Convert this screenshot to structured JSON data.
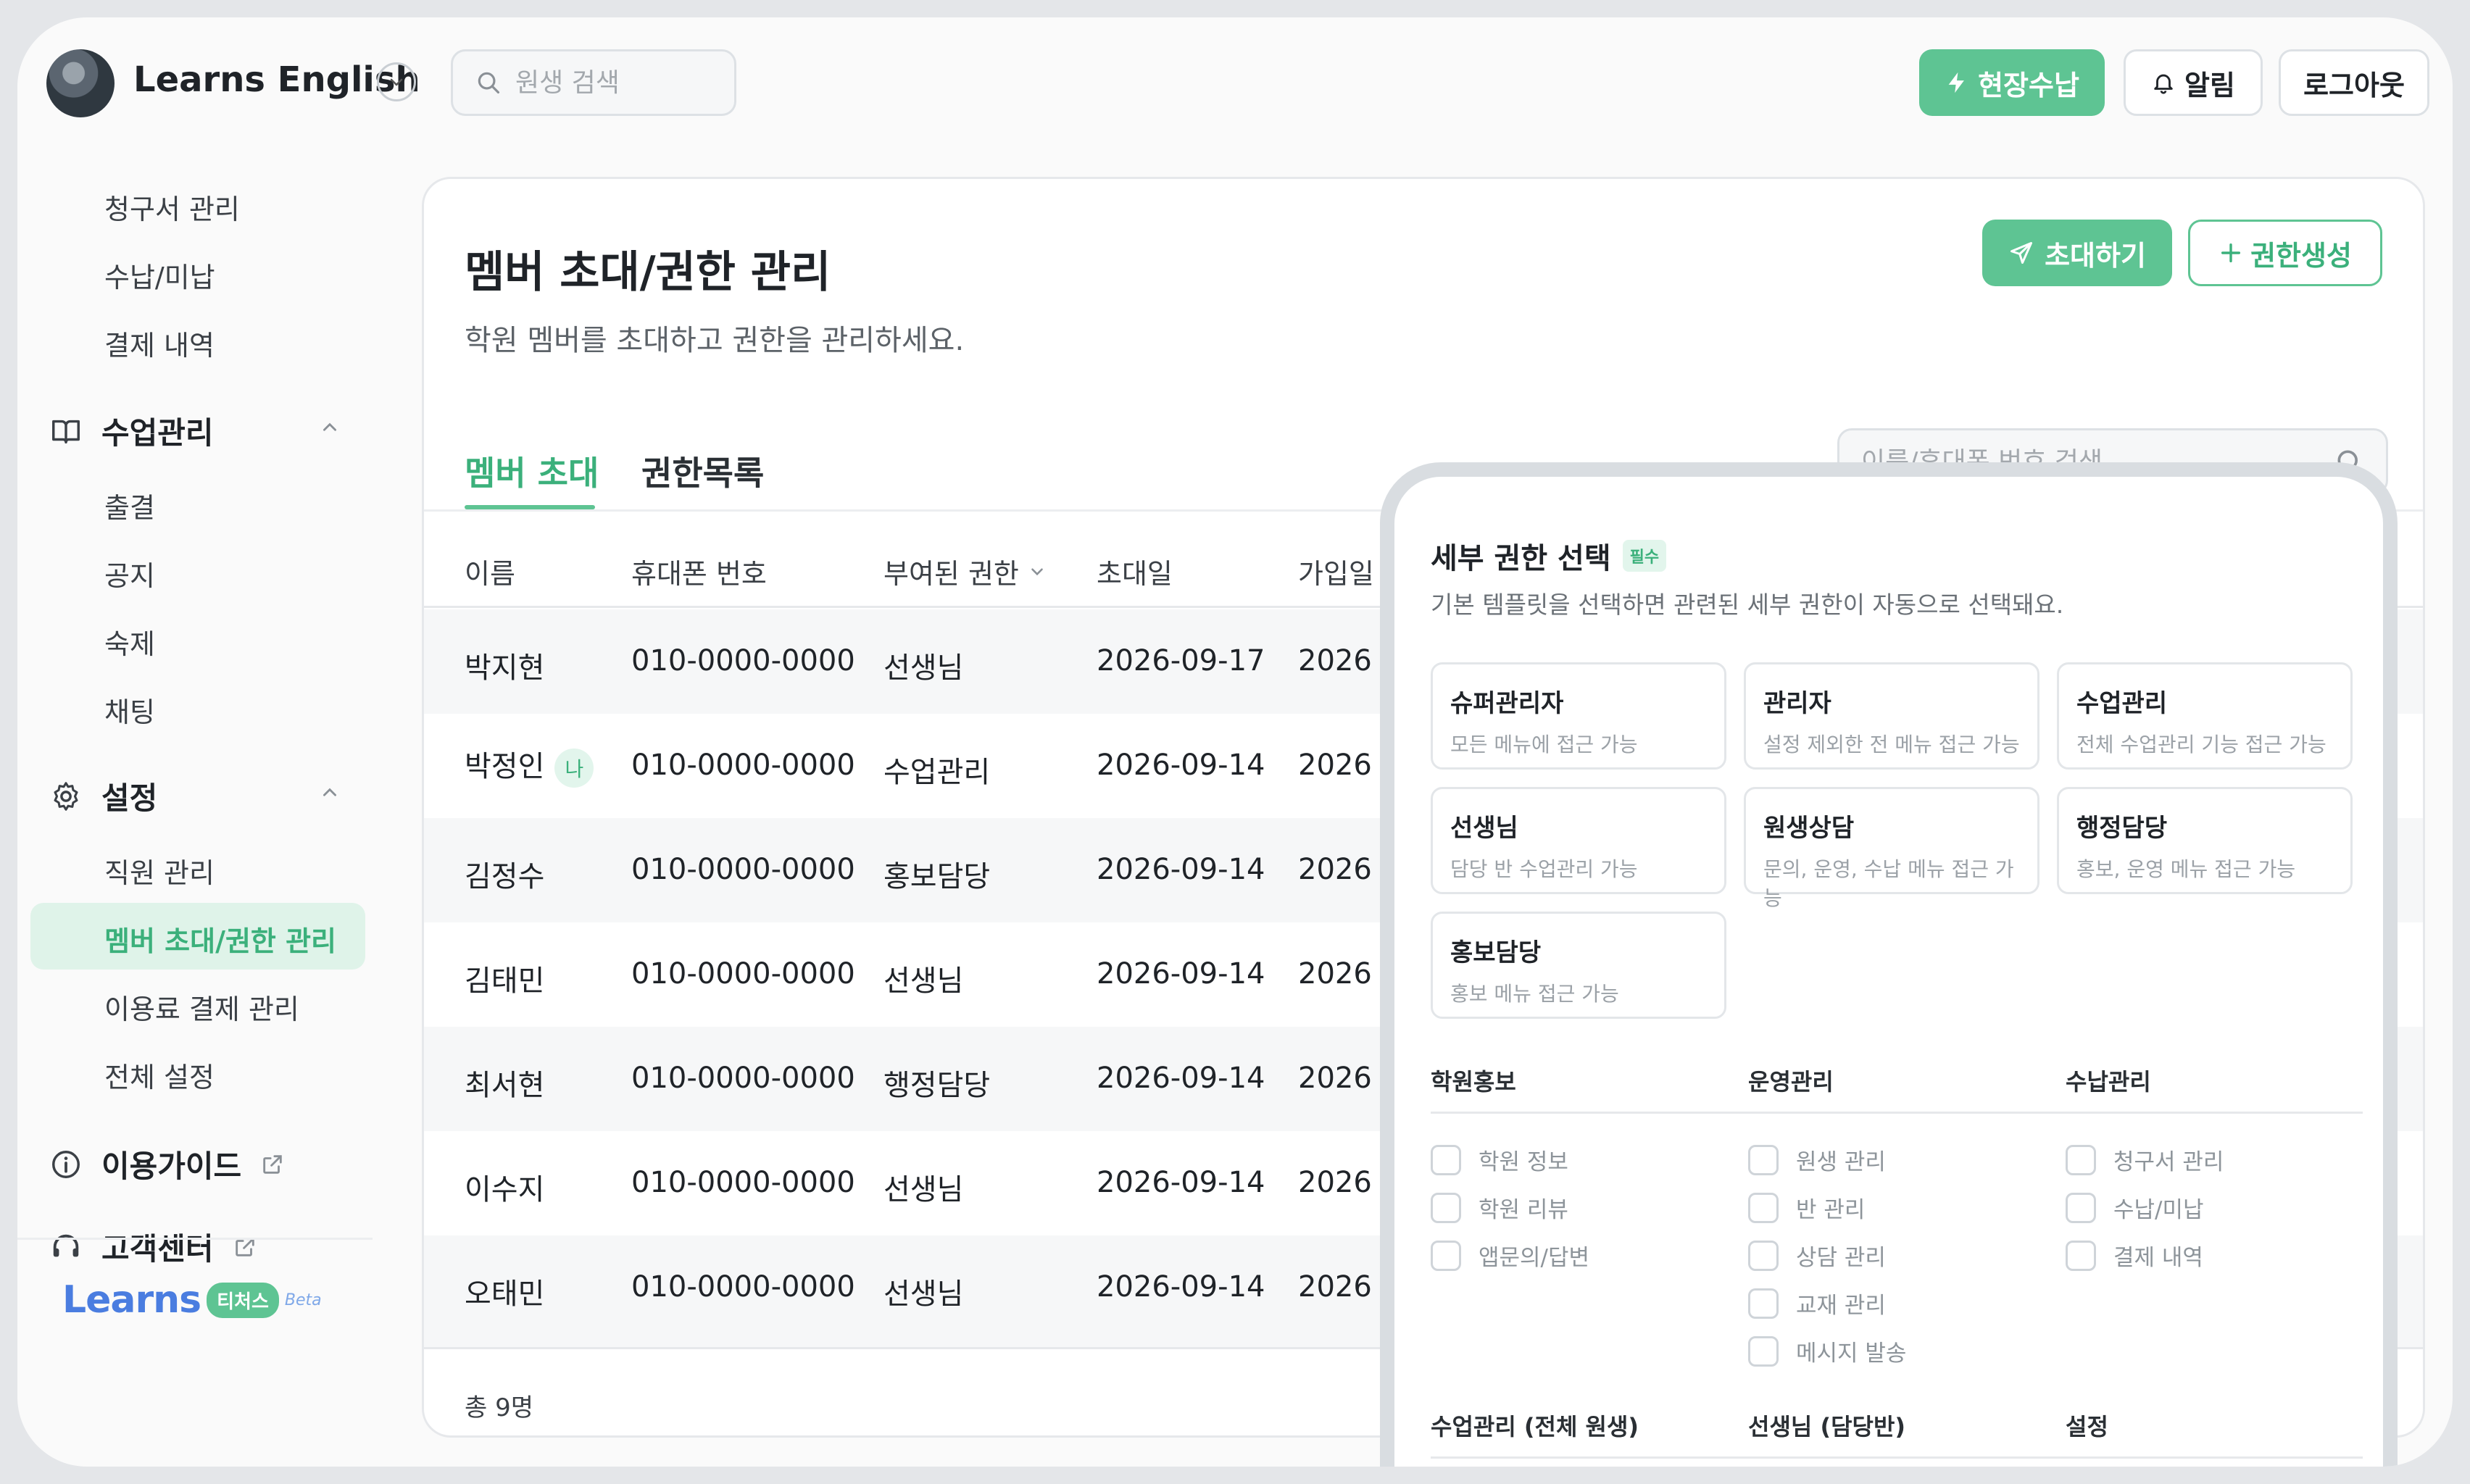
{
  "header": {
    "app_title": "Learns English",
    "search_placeholder": "원생 검색",
    "btn_onsite": "현장수납",
    "btn_notify": "알림",
    "btn_logout": "로그아웃"
  },
  "sidebar": {
    "billing_items": [
      "청구서 관리",
      "수납/미납",
      "결제 내역"
    ],
    "class_group": "수업관리",
    "class_items": [
      "출결",
      "공지",
      "숙제",
      "채팅"
    ],
    "settings_group": "설정",
    "settings_items": [
      "직원 관리",
      "멤버 초대/권한 관리",
      "이용료 결제 관리",
      "전체 설정"
    ],
    "guide": "이용가이드",
    "support": "고객센터",
    "brand": {
      "word": "Learns",
      "pill": "티처스",
      "beta": "Beta"
    }
  },
  "main": {
    "title": "멤버 초대/권한 관리",
    "subtitle": "학원 멤버를 초대하고 권한을 관리하세요.",
    "btn_invite": "초대하기",
    "btn_create": "권한생성",
    "tabs": [
      "멤버 초대",
      "권한목록"
    ],
    "table_search_placeholder": "이름/휴대폰 번호 검색",
    "columns": [
      "이름",
      "휴대폰 번호",
      "부여된 권한",
      "초대일",
      "가입일"
    ],
    "me_badge": "나",
    "rows": [
      {
        "name": "박지현",
        "phone": "010-0000-0000",
        "role": "선생님",
        "invited": "2026-09-17",
        "joined": "2026"
      },
      {
        "name": "박정인",
        "phone": "010-0000-0000",
        "role": "수업관리",
        "invited": "2026-09-14",
        "joined": "2026"
      },
      {
        "name": "김정수",
        "phone": "010-0000-0000",
        "role": "홍보담당",
        "invited": "2026-09-14",
        "joined": "2026"
      },
      {
        "name": "김태민",
        "phone": "010-0000-0000",
        "role": "선생님",
        "invited": "2026-09-14",
        "joined": "2026"
      },
      {
        "name": "최서현",
        "phone": "010-0000-0000",
        "role": "행정담당",
        "invited": "2026-09-14",
        "joined": "2026"
      },
      {
        "name": "이수지",
        "phone": "010-0000-0000",
        "role": "선생님",
        "invited": "2026-09-14",
        "joined": "2026"
      },
      {
        "name": "오태민",
        "phone": "010-0000-0000",
        "role": "선생님",
        "invited": "2026-09-14",
        "joined": "2026"
      }
    ],
    "total": "총 9명"
  },
  "panel": {
    "title": "세부 권한 선택",
    "required": "필수",
    "description": "기본 템플릿을 선택하면 관련된 세부 권한이 자동으로 선택돼요.",
    "templates": [
      {
        "name": "슈퍼관리자",
        "desc": "모든 메뉴에 접근 가능"
      },
      {
        "name": "관리자",
        "desc": "설정 제외한 전 메뉴 접근 가능"
      },
      {
        "name": "수업관리",
        "desc": "전체 수업관리 기능 접근 가능"
      },
      {
        "name": "선생님",
        "desc": "담당 반 수업관리 가능"
      },
      {
        "name": "원생상담",
        "desc": "문의, 운영, 수납 메뉴 접근 가능"
      },
      {
        "name": "행정담당",
        "desc": "홍보, 운영 메뉴 접근 가능"
      },
      {
        "name": "홍보담당",
        "desc": "홍보 메뉴 접근 가능"
      }
    ],
    "groups": [
      {
        "title": "학원홍보",
        "items": [
          "학원 정보",
          "학원 리뷰",
          "앱문의/답변"
        ]
      },
      {
        "title": "운영관리",
        "items": [
          "원생 관리",
          "반 관리",
          "상담 관리",
          "교재 관리",
          "메시지 발송"
        ]
      },
      {
        "title": "수납관리",
        "items": [
          "청구서 관리",
          "수납/미납",
          "결제 내역"
        ]
      }
    ],
    "groups2": [
      "수업관리 (전체 원생)",
      "선생님 (담당반)",
      "설정"
    ]
  },
  "colors": {
    "accent": "#5ec493",
    "accent_text": "#3bb07b",
    "brand_blue": "#4a7de0"
  }
}
